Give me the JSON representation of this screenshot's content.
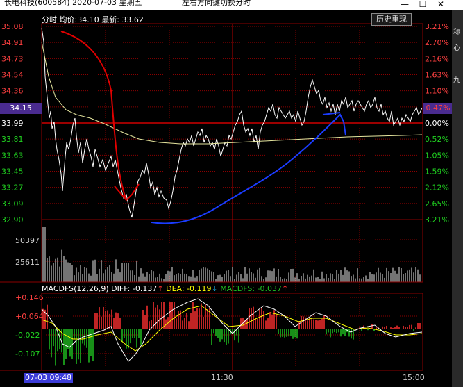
{
  "window": {
    "title": "长电科技(600584) 2020-07-03 星期五",
    "hint": "左右方向键切换分时",
    "min_icon": "—",
    "max_icon": "☐",
    "close_icon": "✕"
  },
  "header": {
    "mode": "分时",
    "avg_label": "均价:",
    "avg_value": "34.10",
    "last_label": "最新:",
    "last_value": "33.62",
    "history_button": "历史重现"
  },
  "price_axis": {
    "labels": [
      "35.08",
      "34.91",
      "34.73",
      "34.54",
      "34.36",
      "34.15",
      "33.99",
      "33.81",
      "33.63",
      "33.45",
      "33.27",
      "33.09",
      "32.90"
    ],
    "current_price": "34.15"
  },
  "pct_axis": {
    "labels": [
      "3.21%",
      "2.70%",
      "2.16%",
      "1.63%",
      "1.10%",
      "0.47%",
      "0.00%",
      "0.52%",
      "1.05%",
      "1.59%",
      "2.12%",
      "2.65%",
      "3.21%"
    ],
    "current_pct": "0.47%"
  },
  "volume_axis": {
    "labels": [
      "50397",
      "25611"
    ]
  },
  "macd": {
    "title": "MACDFS(12,26,9)",
    "diff_label": "DIFF:",
    "diff_value": "-0.137",
    "diff_arrow": "↑",
    "dea_label": "DEA:",
    "dea_value": "-0.119",
    "dea_arrow": "↓",
    "macd_label": "MACDFS:",
    "macd_value": "-0.037",
    "macd_arrow": "↑",
    "axis_labels": [
      "+0.146",
      "+0.064",
      "-0.022",
      "-0.107"
    ]
  },
  "time_axis": {
    "start": "07-03 09:48",
    "mid": "11:30",
    "end": "15:00"
  },
  "right_strip": {
    "chars": [
      "称",
      "心",
      "九"
    ]
  },
  "colors": {
    "up": "#ff3030",
    "down": "#20c020",
    "grid": "#8b0000",
    "price_line": "#ffffff",
    "avg_line": "#e8e8a0",
    "diff": "#ffffff",
    "dea": "#ffff00",
    "annotation_red": "#e00000",
    "annotation_blue": "#1a3cff"
  }
}
